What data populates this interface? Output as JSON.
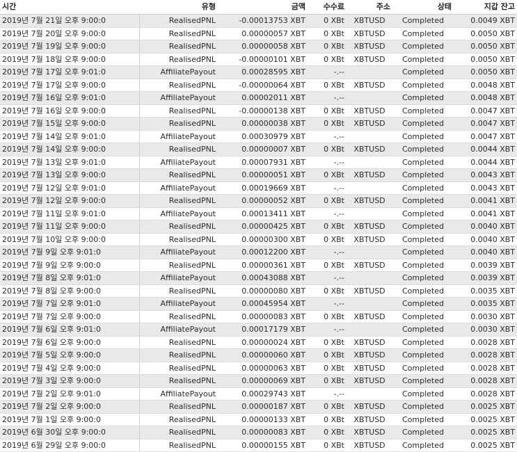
{
  "headers": {
    "time": "시간",
    "type": "유형",
    "amount": "금액",
    "fee": "수수료",
    "address": "주소",
    "status": "상태",
    "wallet": "지갑 잔고"
  },
  "rows": [
    {
      "time": "2019년 7월 21일 오후 9:00:0",
      "type": "RealisedPNL",
      "amount": "-0.00013753 XBT",
      "fee": "0 XBt",
      "address": "XBTUSD",
      "status": "Completed",
      "wallet": "0.0049 XBT"
    },
    {
      "time": "2019년 7월 20일 오후 9:00:0",
      "type": "RealisedPNL",
      "amount": "0.00000057 XBT",
      "fee": "0 XBt",
      "address": "XBTUSD",
      "status": "Completed",
      "wallet": "0.0050 XBT"
    },
    {
      "time": "2019년 7월 19일 오후 9:00:0",
      "type": "RealisedPNL",
      "amount": "0.00000058 XBT",
      "fee": "0 XBt",
      "address": "XBTUSD",
      "status": "Completed",
      "wallet": "0.0050 XBT"
    },
    {
      "time": "2019년 7월 18일 오후 9:00:0",
      "type": "RealisedPNL",
      "amount": "-0.00000101 XBT",
      "fee": "0 XBt",
      "address": "XBTUSD",
      "status": "Completed",
      "wallet": "0.0050 XBT"
    },
    {
      "time": "2019년 7월 17일 오후 9:01:0",
      "type": "AffiliatePayout",
      "amount": "0.00028595 XBT",
      "fee": "-.--",
      "address": "",
      "status": "Completed",
      "wallet": "0.0050 XBT"
    },
    {
      "time": "2019년 7월 17일 오후 9:00:0",
      "type": "RealisedPNL",
      "amount": "-0.00000064 XBT",
      "fee": "0 XBt",
      "address": "XBTUSD",
      "status": "Completed",
      "wallet": "0.0048 XBT"
    },
    {
      "time": "2019년 7월 16일 오후 9:01:0",
      "type": "AffiliatePayout",
      "amount": "0.00002011 XBT",
      "fee": "-.--",
      "address": "",
      "status": "Completed",
      "wallet": "0.0048 XBT"
    },
    {
      "time": "2019년 7월 16일 오후 9:00:0",
      "type": "RealisedPNL",
      "amount": "-0.00000138 XBT",
      "fee": "0 XBt",
      "address": "XBTUSD",
      "status": "Completed",
      "wallet": "0.0047 XBT"
    },
    {
      "time": "2019년 7월 15일 오후 9:00:0",
      "type": "RealisedPNL",
      "amount": "0.00000038 XBT",
      "fee": "0 XBt",
      "address": "XBTUSD",
      "status": "Completed",
      "wallet": "0.0047 XBT"
    },
    {
      "time": "2019년 7월 14일 오후 9:01:0",
      "type": "AffiliatePayout",
      "amount": "0.00030979 XBT",
      "fee": "-.--",
      "address": "",
      "status": "Completed",
      "wallet": "0.0047 XBT"
    },
    {
      "time": "2019년 7월 14일 오후 9:00:0",
      "type": "RealisedPNL",
      "amount": "0.00000007 XBT",
      "fee": "0 XBt",
      "address": "XBTUSD",
      "status": "Completed",
      "wallet": "0.0044 XBT"
    },
    {
      "time": "2019년 7월 13일 오후 9:01:0",
      "type": "AffiliatePayout",
      "amount": "0.00007931 XBT",
      "fee": "-.--",
      "address": "",
      "status": "Completed",
      "wallet": "0.0044 XBT"
    },
    {
      "time": "2019년 7월 13일 오후 9:00:0",
      "type": "RealisedPNL",
      "amount": "0.00000051 XBT",
      "fee": "0 XBt",
      "address": "XBTUSD",
      "status": "Completed",
      "wallet": "0.0043 XBT"
    },
    {
      "time": "2019년 7월 12일 오후 9:01:0",
      "type": "AffiliatePayout",
      "amount": "0.00019669 XBT",
      "fee": "-.--",
      "address": "",
      "status": "Completed",
      "wallet": "0.0043 XBT"
    },
    {
      "time": "2019년 7월 12일 오후 9:00:0",
      "type": "RealisedPNL",
      "amount": "0.00000052 XBT",
      "fee": "0 XBt",
      "address": "XBTUSD",
      "status": "Completed",
      "wallet": "0.0041 XBT"
    },
    {
      "time": "2019년 7월 11일 오후 9:01:0",
      "type": "AffiliatePayout",
      "amount": "0.00013411 XBT",
      "fee": "-.--",
      "address": "",
      "status": "Completed",
      "wallet": "0.0041 XBT"
    },
    {
      "time": "2019년 7월 11일 오후 9:00:0",
      "type": "RealisedPNL",
      "amount": "0.00000425 XBT",
      "fee": "0 XBt",
      "address": "XBTUSD",
      "status": "Completed",
      "wallet": "0.0040 XBT"
    },
    {
      "time": "2019년 7월 10일 오후 9:00:0",
      "type": "RealisedPNL",
      "amount": "0.00000300 XBT",
      "fee": "0 XBt",
      "address": "XBTUSD",
      "status": "Completed",
      "wallet": "0.0040 XBT"
    },
    {
      "time": "2019년 7월 9일 오후 9:01:0",
      "type": "AffiliatePayout",
      "amount": "0.00012200 XBT",
      "fee": "-.--",
      "address": "",
      "status": "Completed",
      "wallet": "0.0040 XBT"
    },
    {
      "time": "2019년 7월 9일 오후 9:00:0",
      "type": "RealisedPNL",
      "amount": "0.00000361 XBT",
      "fee": "0 XBt",
      "address": "XBTUSD",
      "status": "Completed",
      "wallet": "0.0039 XBT"
    },
    {
      "time": "2019년 7월 8일 오후 9:01:0",
      "type": "AffiliatePayout",
      "amount": "0.00043088 XBT",
      "fee": "-.--",
      "address": "",
      "status": "Completed",
      "wallet": "0.0039 XBT"
    },
    {
      "time": "2019년 7월 8일 오후 9:00:0",
      "type": "RealisedPNL",
      "amount": "0.00000080 XBT",
      "fee": "0 XBt",
      "address": "XBTUSD",
      "status": "Completed",
      "wallet": "0.0035 XBT"
    },
    {
      "time": "2019년 7월 7일 오후 9:01:0",
      "type": "AffiliatePayout",
      "amount": "0.00045954 XBT",
      "fee": "-.--",
      "address": "",
      "status": "Completed",
      "wallet": "0.0035 XBT"
    },
    {
      "time": "2019년 7월 7일 오후 9:00:0",
      "type": "RealisedPNL",
      "amount": "0.00000083 XBT",
      "fee": "0 XBt",
      "address": "XBTUSD",
      "status": "Completed",
      "wallet": "0.0030 XBT"
    },
    {
      "time": "2019년 7월 6일 오후 9:01:0",
      "type": "AffiliatePayout",
      "amount": "0.00017179 XBT",
      "fee": "-.--",
      "address": "",
      "status": "Completed",
      "wallet": "0.0030 XBT"
    },
    {
      "time": "2019년 7월 6일 오후 9:00:0",
      "type": "RealisedPNL",
      "amount": "0.00000024 XBT",
      "fee": "0 XBt",
      "address": "XBTUSD",
      "status": "Completed",
      "wallet": "0.0028 XBT"
    },
    {
      "time": "2019년 7월 5일 오후 9:00:0",
      "type": "RealisedPNL",
      "amount": "0.00000060 XBT",
      "fee": "0 XBt",
      "address": "XBTUSD",
      "status": "Completed",
      "wallet": "0.0028 XBT"
    },
    {
      "time": "2019년 7월 4일 오후 9:00:0",
      "type": "RealisedPNL",
      "amount": "0.00000063 XBT",
      "fee": "0 XBt",
      "address": "XBTUSD",
      "status": "Completed",
      "wallet": "0.0028 XBT"
    },
    {
      "time": "2019년 7월 3일 오후 9:00:0",
      "type": "RealisedPNL",
      "amount": "0.00000069 XBT",
      "fee": "0 XBt",
      "address": "XBTUSD",
      "status": "Completed",
      "wallet": "0.0028 XBT"
    },
    {
      "time": "2019년 7월 2일 오후 9:01:0",
      "type": "AffiliatePayout",
      "amount": "0.00029743 XBT",
      "fee": "-.--",
      "address": "",
      "status": "Completed",
      "wallet": "0.0028 XBT"
    },
    {
      "time": "2019년 7월 2일 오후 9:00:0",
      "type": "RealisedPNL",
      "amount": "0.00000187 XBT",
      "fee": "0 XBt",
      "address": "XBTUSD",
      "status": "Completed",
      "wallet": "0.0025 XBT"
    },
    {
      "time": "2019년 7월 1일 오후 9:00:0",
      "type": "RealisedPNL",
      "amount": "0.00000133 XBT",
      "fee": "0 XBt",
      "address": "XBTUSD",
      "status": "Completed",
      "wallet": "0.0025 XBT"
    },
    {
      "time": "2019년 6월 30일 오후 9:00:0",
      "type": "RealisedPNL",
      "amount": "0.00000083 XBT",
      "fee": "0 XBt",
      "address": "XBTUSD",
      "status": "Completed",
      "wallet": "0.0025 XBT"
    },
    {
      "time": "2019년 6월 29일 오후 9:00:0",
      "type": "RealisedPNL",
      "amount": "0.00000155 XBT",
      "fee": "0 XBt",
      "address": "XBTUSD",
      "status": "Completed",
      "wallet": "0.0025 XBT"
    }
  ]
}
